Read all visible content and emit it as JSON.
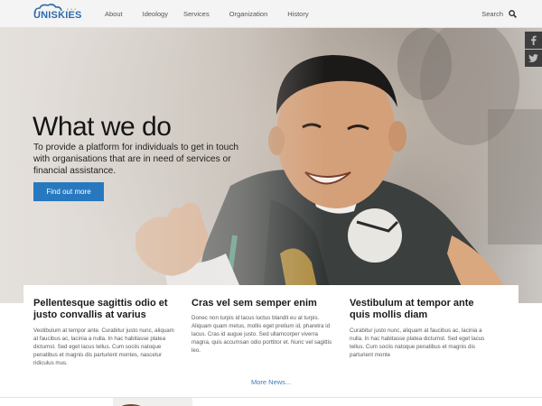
{
  "brand": {
    "name": "UNISKIES",
    "tagline_dots": "• • •"
  },
  "nav": {
    "items": [
      {
        "label": "About"
      },
      {
        "label": "Ideology"
      },
      {
        "label": "Services"
      },
      {
        "label": "Organization"
      },
      {
        "label": "History"
      }
    ],
    "search_label": "Search"
  },
  "social": {
    "icons": [
      "facebook-icon",
      "twitter-icon"
    ]
  },
  "hero": {
    "title": "What we do",
    "subtitle": "To provide a platform for individuals to get in touch with organisations that are in need of services or financial assistance.",
    "button_label": "Find out more"
  },
  "news": {
    "columns": [
      {
        "title": "Pellentesque sagittis odio et justo convallis at varius",
        "text": "Vestibulum at tempor ante. Curabitur justo nunc, aliquam at faucibus ac, lacinia a nulla. In hac habitasse platea dictumst. Sed eget lacus tellus. Cum sociis natoque penatibus et magnis dis parturient montes, nascetur ridiculus mus."
      },
      {
        "title": "Cras vel sem semper enim",
        "text": "Donec non turpis id lacus luctus blandit eu at turpis. Aliquam quam metus, mollis eget pretium id, pharetra id lacus. Cras id augue justo. Sed ullamcorper viverra magna, quis accumsan odio porttitor et. Nunc vel sagittis leo."
      },
      {
        "title": "Vestibulum at tempor ante quis mollis diam",
        "text": "Curabitur justo nunc, aliquam at faucibus ac, lacinia a nulla. In hac habitasse platea dictumst. Sed eget lacus tellus. Cum sociis natoque penatibus et magnis dis parturient monte"
      }
    ],
    "more_label": "More News..."
  },
  "colors": {
    "accent": "#2878bf",
    "brand_blue": "#2f6aab",
    "link": "#3f7ab8",
    "header_bg": "#f4f4f4",
    "social_bg": "#3e3e3e"
  }
}
